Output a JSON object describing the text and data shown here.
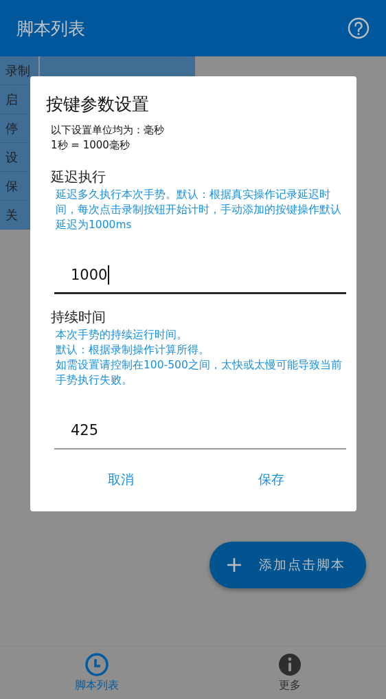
{
  "app_bar": {
    "title": "脚本列表"
  },
  "side_menu": [
    {
      "label": "录制"
    },
    {
      "label": "启"
    },
    {
      "label": "停"
    },
    {
      "label": "设"
    },
    {
      "label": "保"
    },
    {
      "label": "关"
    }
  ],
  "dialog": {
    "title": "按键参数设置",
    "note_lines": [
      "以下设置单位均为：毫秒",
      "1秒 = 1000毫秒"
    ],
    "sections": [
      {
        "label": "延迟执行",
        "help_lines": [
          "延迟多久执行本次手势。默认：根据真实操作记录延迟时间，每次点击录制按钮开始计时，手动添加的按键操作默认延迟为1000ms"
        ],
        "value": "1000",
        "focused": true
      },
      {
        "label": "持续时间",
        "help_lines": [
          "本次手势的持续运行时间。",
          "默认：根据录制操作计算所得。",
          "如需设置请控制在100-500之间，太快或太慢可能导致当前手势执行失败。"
        ],
        "value": "425",
        "focused": false
      }
    ],
    "buttons": [
      "取消",
      "保存"
    ]
  },
  "fab": {
    "label": "添加点击脚本"
  },
  "bottom_nav": [
    {
      "label": "脚本列表",
      "kind": "clock",
      "selected": true
    },
    {
      "label": "更多",
      "kind": "info",
      "selected": false
    }
  ]
}
